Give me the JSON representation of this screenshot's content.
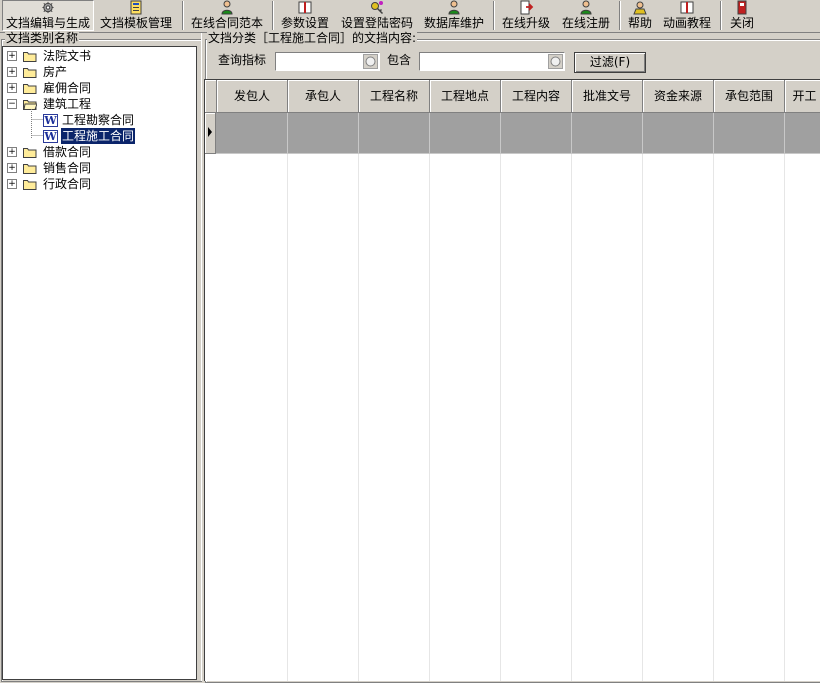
{
  "toolbar": {
    "buttons": [
      {
        "label": "文挡编辑与生成",
        "icon": "gear-icon"
      },
      {
        "label": "文挡模板管理",
        "icon": "template-icon"
      },
      {
        "label": "在线合同范本",
        "icon": "person-icon"
      },
      {
        "label": "参数设置",
        "icon": "book-icon"
      },
      {
        "label": "设置登陆密码",
        "icon": "key-icon"
      },
      {
        "label": "数据库维护",
        "icon": "person-icon"
      },
      {
        "label": "在线升级",
        "icon": "arrow-icon"
      },
      {
        "label": "在线注册",
        "icon": "person-icon"
      },
      {
        "label": "帮助",
        "icon": "help-icon"
      },
      {
        "label": "动画教程",
        "icon": "book-icon"
      },
      {
        "label": "关闭",
        "icon": "close-icon"
      }
    ]
  },
  "left_panel": {
    "title": "文挡类别名称",
    "tree": [
      {
        "label": "法院文书",
        "expander": "+"
      },
      {
        "label": "房产",
        "expander": "+"
      },
      {
        "label": "雇佣合同",
        "expander": "+"
      },
      {
        "label": "建筑工程",
        "expander": "−"
      },
      {
        "label": "工程勘察合同"
      },
      {
        "label": "工程施工合同"
      },
      {
        "label": "借款合同",
        "expander": "+"
      },
      {
        "label": "销售合同",
        "expander": "+"
      },
      {
        "label": "行政合同",
        "expander": "+"
      }
    ],
    "doc_icon_letter": "W"
  },
  "right_panel": {
    "title": "文挡分类［工程施工合同］的文挡内容:",
    "query_label": "查询指标",
    "query_value": "",
    "contains_label": "包含",
    "contains_value": "",
    "filter_button": "过滤(F)",
    "columns": [
      "发包人",
      "承包人",
      "工程名称",
      "工程地点",
      "工程内容",
      "批准文号",
      "资金来源",
      "承包范围",
      "开工"
    ]
  },
  "colors": {
    "window": "#d4d0c8",
    "selection": "#0a246a",
    "empty_row": "#a0a0a0"
  }
}
